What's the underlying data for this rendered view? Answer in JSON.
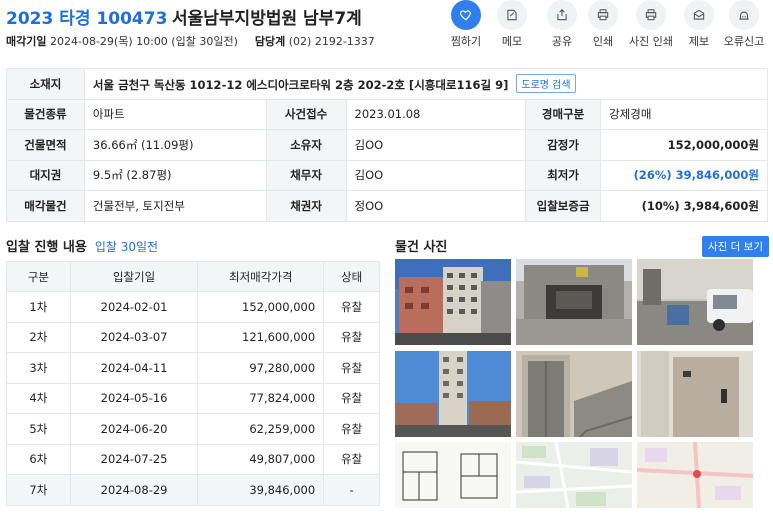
{
  "header": {
    "case_no": "2023 타경 100473",
    "court": "서울남부지방법원 남부7계",
    "sale_date_label": "매각기일",
    "sale_date_value": "2024-08-29(목) 10:00 (입찰 30일전)",
    "contact_label": "담당계",
    "contact_value": "(02) 2192-1337",
    "actions": [
      {
        "label": "찜하기",
        "icon": "heart-icon"
      },
      {
        "label": "메모",
        "icon": "memo-icon"
      },
      {
        "label": "공유",
        "icon": "share-icon"
      },
      {
        "label": "인쇄",
        "icon": "print-icon"
      },
      {
        "label": "사진 인쇄",
        "icon": "photo-print-icon"
      },
      {
        "label": "제보",
        "icon": "report-icon"
      },
      {
        "label": "오류신고",
        "icon": "error-report-icon"
      }
    ]
  },
  "info": {
    "address_label": "소재지",
    "address_value": "서울 금천구 독산동 1012-12 에스디아크로타워 2층 202-2호 [시흥대로116길 9]",
    "road_search_label": "도로명 검색",
    "type_label": "물건종류",
    "type_value": "아파트",
    "case_date_label": "사건접수",
    "case_date_value": "2023.01.08",
    "auction_type_label": "경매구분",
    "auction_type_value": "강제경매",
    "building_area_label": "건물면적",
    "building_area_value": "36.66㎡ (11.09평)",
    "owner_label": "소유자",
    "owner_value": "김OO",
    "appraisal_label": "감정가",
    "appraisal_value": "152,000,000원",
    "land_right_label": "대지권",
    "land_right_value": "9.5㎡ (2.87평)",
    "debtor_label": "채무자",
    "debtor_value": "김OO",
    "min_price_label": "최저가",
    "min_price_value": "(26%) 39,846,000원",
    "sale_item_label": "매각물건",
    "sale_item_value": "건물전부, 토지전부",
    "creditor_label": "채권자",
    "creditor_value": "정OO",
    "deposit_label": "입찰보증금",
    "deposit_value": "(10%) 3,984,600원"
  },
  "bids": {
    "title": "입찰 진행 내용",
    "subtitle": "입찰 30일전",
    "headers": [
      "구분",
      "입찰기일",
      "최저매각가격",
      "상태"
    ],
    "rows": [
      {
        "round": "1차",
        "date": "2024-02-01",
        "price": "152,000,000",
        "status": "유찰"
      },
      {
        "round": "2차",
        "date": "2024-03-07",
        "price": "121,600,000",
        "status": "유찰"
      },
      {
        "round": "3차",
        "date": "2024-04-11",
        "price": "97,280,000",
        "status": "유찰"
      },
      {
        "round": "4차",
        "date": "2024-05-16",
        "price": "77,824,000",
        "status": "유찰"
      },
      {
        "round": "5차",
        "date": "2024-06-20",
        "price": "62,259,000",
        "status": "유찰"
      },
      {
        "round": "6차",
        "date": "2024-07-25",
        "price": "49,807,000",
        "status": "유찰"
      },
      {
        "round": "7차",
        "date": "2024-08-29",
        "price": "39,846,000",
        "status": "-"
      }
    ]
  },
  "photos": {
    "title": "물건 사진",
    "more_label": "사진 더 보기",
    "colors": {
      "accent": "#2f80ed",
      "brand_blue": "#1f6fd8"
    }
  }
}
